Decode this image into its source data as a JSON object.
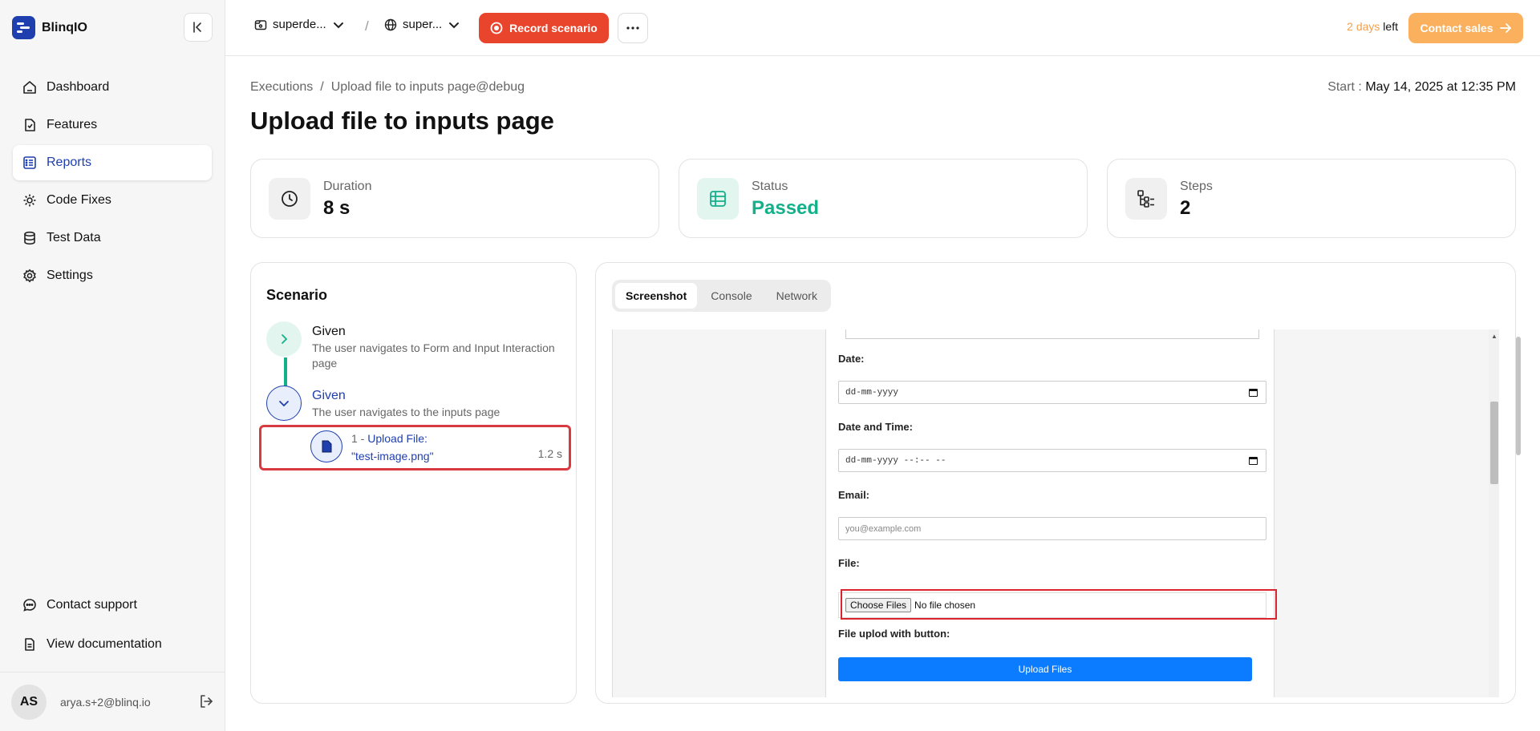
{
  "app": {
    "name": "BlinqIO"
  },
  "sidebar": {
    "items": [
      {
        "label": "Dashboard",
        "icon": "home-icon"
      },
      {
        "label": "Features",
        "icon": "features-icon"
      },
      {
        "label": "Reports",
        "icon": "reports-icon",
        "active": true
      },
      {
        "label": "Code Fixes",
        "icon": "code-fix-icon"
      },
      {
        "label": "Test Data",
        "icon": "database-icon"
      },
      {
        "label": "Settings",
        "icon": "gear-icon"
      }
    ],
    "bottom_items": [
      {
        "label": "Contact support",
        "icon": "chat-icon"
      },
      {
        "label": "View documentation",
        "icon": "document-icon"
      }
    ],
    "user": {
      "initials": "AS",
      "email": "arya.s+2@blinq.io"
    }
  },
  "topbar": {
    "project": "superde...",
    "environment": "super...",
    "separator": "/",
    "record_label": "Record scenario",
    "trial_days": "2 days",
    "trial_suffix": " left",
    "contact_sales": "Contact sales"
  },
  "breadcrumb": {
    "root": "Executions",
    "separator": "/",
    "current": "Upload file to inputs page@debug"
  },
  "start": {
    "label": "Start :",
    "value": "May 14, 2025 at 12:35 PM"
  },
  "page_title": "Upload file to inputs page",
  "stats": {
    "duration": {
      "label": "Duration",
      "value": "8 s"
    },
    "status": {
      "label": "Status",
      "value": "Passed"
    },
    "steps": {
      "label": "Steps",
      "value": "2"
    }
  },
  "scenario": {
    "title": "Scenario",
    "steps": [
      {
        "keyword": "Given",
        "text": "The user navigates to Form and Input Interaction page"
      },
      {
        "keyword": "Given",
        "text": "The user navigates to the inputs page"
      }
    ],
    "substep": {
      "number": "1 -",
      "action": "Upload File:",
      "value": "\"test-image.png\"",
      "duration": "1.2 s"
    }
  },
  "viewer": {
    "tabs": [
      "Screenshot",
      "Console",
      "Network"
    ],
    "active_tab": "Screenshot",
    "screenshot": {
      "date_label": "Date:",
      "date_placeholder": "dd-mm-yyyy",
      "datetime_label": "Date and Time:",
      "datetime_placeholder": "dd-mm-yyyy --:-- --",
      "email_label": "Email:",
      "email_placeholder": "you@example.com",
      "file_label": "File:",
      "choose_files": "Choose Files",
      "no_file": "No file chosen",
      "file_button_label": "File uplod with button:",
      "upload_button": "Upload Files"
    }
  },
  "colors": {
    "brand": "#1f3fae",
    "record": "#e8452c",
    "passed": "#14b089",
    "contact_sales": "#fbb05e",
    "highlight": "#d93a3f",
    "upload_button": "#0b7cff"
  }
}
